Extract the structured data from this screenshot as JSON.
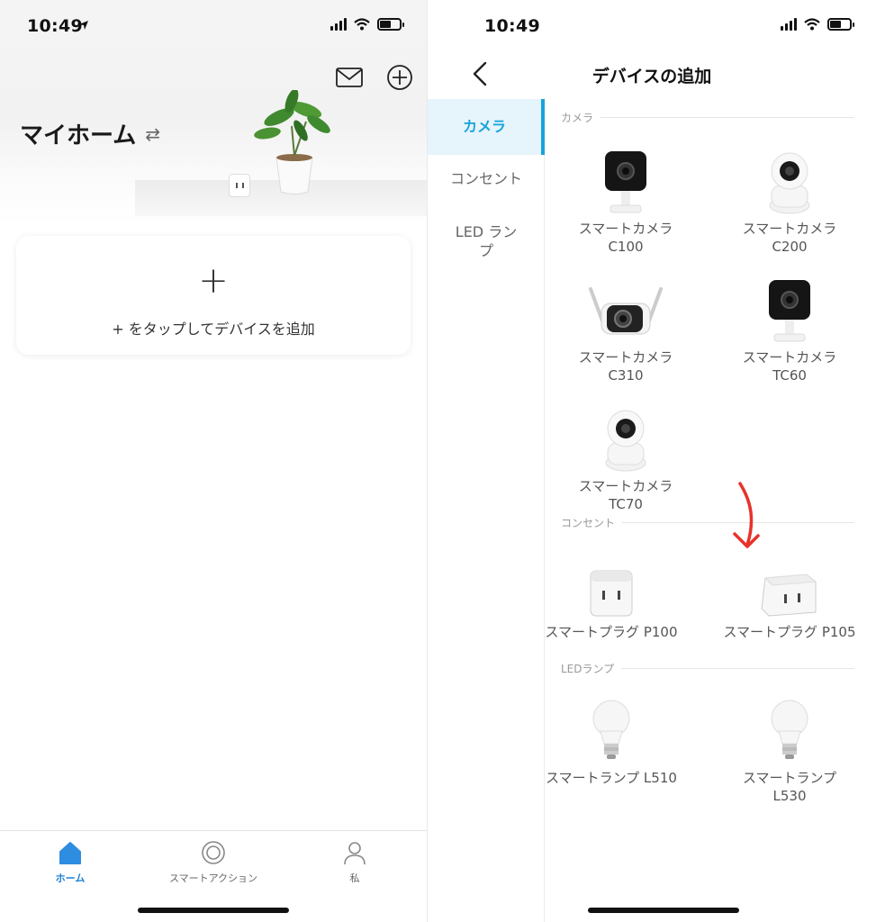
{
  "left": {
    "status": {
      "time": "10:49"
    },
    "hero": {
      "title": "マイホーム",
      "swap_icon": "swap-icon"
    },
    "header_icons": [
      "mail-icon",
      "plus-circle-icon"
    ],
    "add_card": {
      "plus": "+",
      "hint": "+ をタップしてデバイスを追加"
    },
    "tabs": [
      {
        "label": "ホーム",
        "icon": "home-icon",
        "active": true
      },
      {
        "label": "スマートアクション",
        "icon": "smart-action-icon",
        "active": false
      },
      {
        "label": "私",
        "icon": "person-icon",
        "active": false
      }
    ],
    "accent": "#1d7fd6"
  },
  "right": {
    "status": {
      "time": "10:49"
    },
    "nav": {
      "title": "デバイスの追加",
      "back_icon": "chevron-left-icon"
    },
    "sidebar": [
      {
        "label": "カメラ",
        "active": true
      },
      {
        "label": "コンセント",
        "active": false
      },
      {
        "label": "LED ランプ",
        "active": false
      }
    ],
    "sections": [
      {
        "title": "カメラ",
        "devices": [
          {
            "line1": "スマートカメラ",
            "line2": "C100"
          },
          {
            "line1": "スマートカメラ",
            "line2": "C200"
          },
          {
            "line1": "スマートカメラ",
            "line2": "C310"
          },
          {
            "line1": "スマートカメラ",
            "line2": "TC60"
          },
          {
            "line1": "スマートカメラ",
            "line2": "TC70"
          }
        ]
      },
      {
        "title": "コンセント",
        "devices": [
          {
            "line1": "スマートプラグ P100",
            "line2": ""
          },
          {
            "line1": "スマートプラグ P105",
            "line2": ""
          }
        ]
      },
      {
        "title": "LEDランプ",
        "devices": [
          {
            "line1": "スマートランプ L510",
            "line2": ""
          },
          {
            "line1": "スマートランプ",
            "line2": "L530"
          }
        ]
      }
    ],
    "accent": "#17a3da",
    "annotation_color": "#e8322b"
  }
}
